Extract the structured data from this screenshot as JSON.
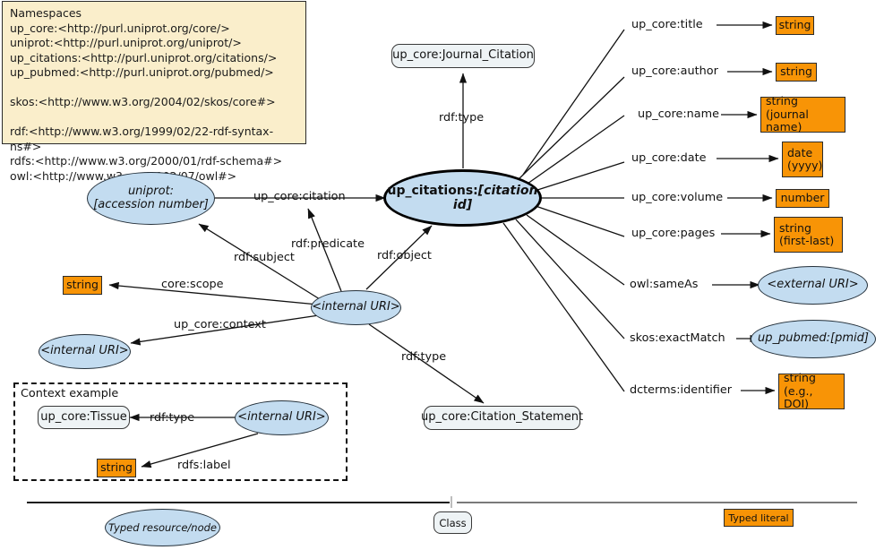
{
  "namespaces": {
    "title": "Namespaces",
    "text": "Namespaces\nup_core:<http://purl.uniprot.org/core/>\nuniprot:<http://purl.uniprot.org/uniprot/>\nup_citations:<http://purl.uniprot.org/citations/>\nup_pubmed:<http://purl.uniprot.org/pubmed/>\n\nskos:<http://www.w3.org/2004/02/skos/core#>\n\nrdf:<http://www.w3.org/1999/02/22-rdf-syntax-ns#>\nrdfs:<http://www.w3.org/2000/01/rdf-schema#>\nowl:<http://www.w3.org/2002/07/owl#>"
  },
  "nodes": {
    "main_citation": {
      "prefix": "up_citations:",
      "local": "[citation id]"
    },
    "journal_citation_class": {
      "label": "up_core:Journal_Citation"
    },
    "citation_statement_class": {
      "label": "up_core:Citation_Statement"
    },
    "uniprot_accession": {
      "line1": "uniprot:",
      "line2": "[accession number]"
    },
    "internal_uri_center": {
      "label": "<internal URI>"
    },
    "internal_uri_context": {
      "label": "<internal URI>"
    },
    "external_uri": {
      "label": "<external URI>"
    },
    "pubmed": {
      "label": "up_pubmed:[pmid]"
    },
    "core_scope_string": {
      "label": "string"
    }
  },
  "literals": {
    "title_string": {
      "label": "string"
    },
    "author_string": {
      "label": "string"
    },
    "name_string": {
      "line1": "string",
      "line2": "(journal name)"
    },
    "date_literal": {
      "line1": "date",
      "line2": "(yyyy)"
    },
    "volume_number": {
      "label": "number"
    },
    "pages_string": {
      "line1": "string",
      "line2": "(first-last)"
    },
    "identifier_string": {
      "line1": "string",
      "line2": "(e.g., DOI)"
    },
    "context_label_string": {
      "label": "string"
    }
  },
  "edges": {
    "rdf_type_journal": "rdf:type",
    "rdf_type_statement": "rdf:type",
    "rdf_type_context": "rdf:type",
    "up_core_citation": "up_core:citation",
    "rdf_subject": "rdf:subject",
    "rdf_predicate": "rdf:predicate",
    "rdf_object": "rdf:object",
    "core_scope": "core:scope",
    "up_core_context": "up_core:context",
    "rdfs_label": "rdfs:label",
    "up_core_title": "up_core:title",
    "up_core_author": "up_core:author",
    "up_core_name": "up_core:name",
    "up_core_date": "up_core:date",
    "up_core_volume": "up_core:volume",
    "up_core_pages": "up_core:pages",
    "owl_sameAs": "owl:sameAs",
    "skos_exactMatch": "skos:exactMatch",
    "dcterms_identifier": "dcterms:identifier"
  },
  "context_example": {
    "title": "Context example",
    "tissue_class": "up_core:Tissue"
  },
  "legend": {
    "resource": "Typed resource/node",
    "class": "Class",
    "literal": "Typed literal"
  },
  "colors": {
    "literal_orange": "#f89406",
    "node_blue": "#c3dcf0",
    "class_grey": "#eef3f5",
    "namespace_cream": "#faeecb",
    "stroke": "#1a1a1a"
  }
}
